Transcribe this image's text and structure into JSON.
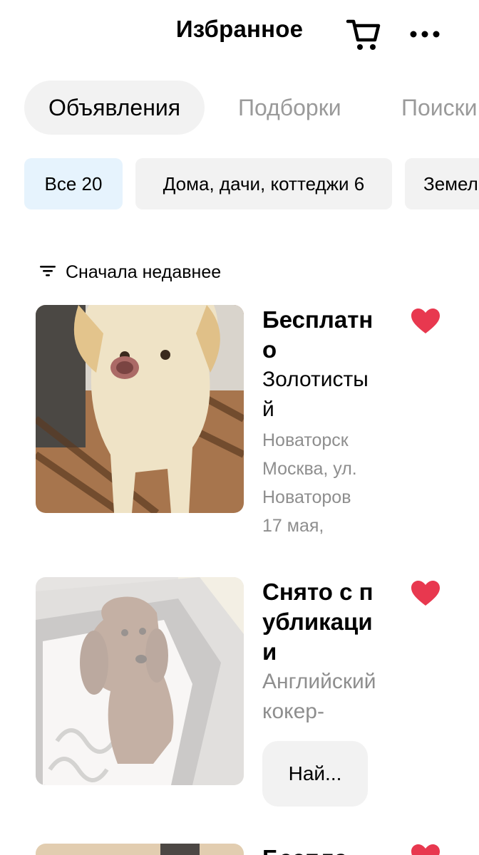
{
  "header": {
    "title": "Избранное",
    "cart_icon": "cart-icon",
    "more_icon": "more-icon"
  },
  "tabs": [
    {
      "label": "Объявления",
      "active": true
    },
    {
      "label": "Подборки",
      "active": false
    },
    {
      "label": "Поиски",
      "active": false
    }
  ],
  "filters": [
    {
      "label": "Все 20",
      "active": true
    },
    {
      "label": "Дома, дачи, коттеджи 6",
      "active": false
    },
    {
      "label": "Земел",
      "active": false
    }
  ],
  "sort": {
    "icon": "sort-icon",
    "label": "Сначала недавнее"
  },
  "listings": [
    {
      "price": "Бесплатно",
      "title": "Золотистый",
      "address_lines": [
        "Новаторск",
        "Москва, ул.",
        "Новаторов",
        "17 мая,"
      ],
      "favorite": true
    },
    {
      "status": "Снято с публикации",
      "title": "Английский кокер-",
      "find_button": "Най...",
      "favorite": true
    },
    {
      "price": "Беспла",
      "favorite": true
    }
  ],
  "colors": {
    "heart": "#e8384f",
    "chip_active": "#e6f3fd",
    "chip": "#f2f2f2",
    "muted_text": "#8e8e8e"
  }
}
